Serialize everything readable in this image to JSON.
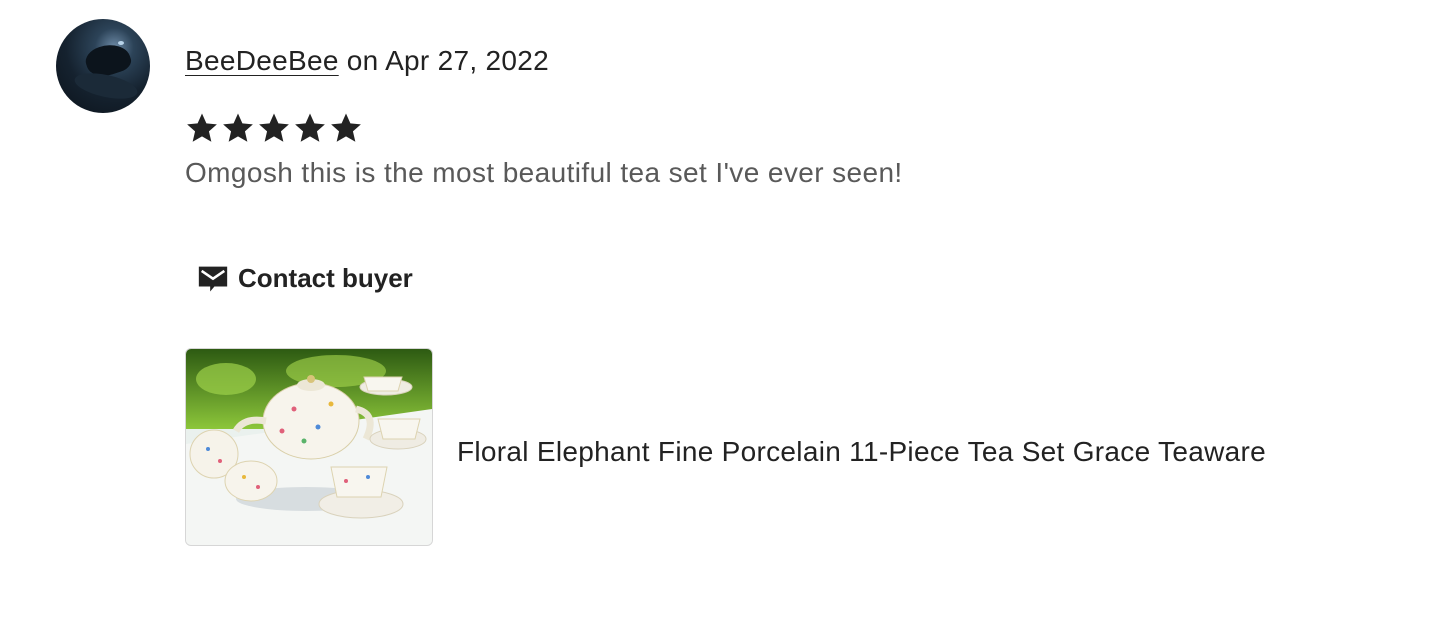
{
  "review": {
    "username": "BeeDeeBee",
    "date_text": " on Apr 27, 2022",
    "rating": 5,
    "rating_max": 5,
    "text": "Omgosh this is the most beautiful tea set I've ever seen!"
  },
  "contact": {
    "label": "Contact buyer",
    "icon": "mail-icon"
  },
  "product": {
    "title": "Floral Elephant Fine Porcelain 11-Piece Tea Set Grace Teaware",
    "image_icon": "tea-set-photo"
  },
  "colors": {
    "text": "#222222",
    "muted_text": "#595959",
    "star": "#222222"
  }
}
